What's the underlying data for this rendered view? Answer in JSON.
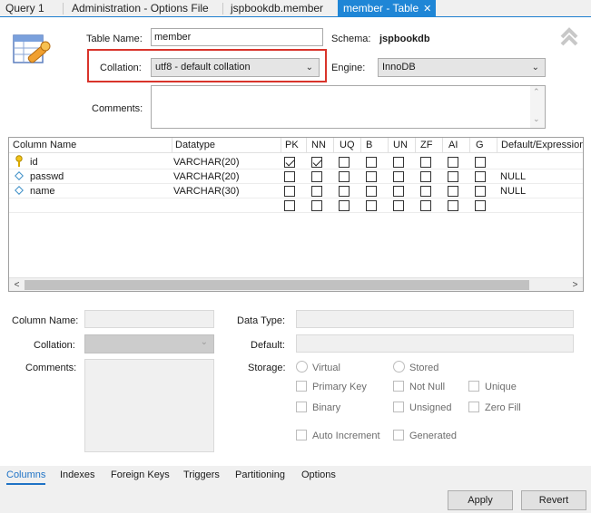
{
  "tabs": [
    {
      "label": "Query 1"
    },
    {
      "label": "Administration - Options File"
    },
    {
      "label": "jspbookdb.member"
    },
    {
      "label": "member - Table",
      "active": true
    }
  ],
  "tab_close_glyph": "✕",
  "table_form": {
    "table_name_label": "Table Name:",
    "table_name_value": "member",
    "schema_label": "Schema:",
    "schema_value": "jspbookdb",
    "collation_label": "Collation:",
    "collation_value": "utf8 - default collation",
    "engine_label": "Engine:",
    "engine_value": "InnoDB",
    "comments_label": "Comments:",
    "comments_value": "",
    "highlight_color": "#d9342b"
  },
  "grid": {
    "headers": [
      "Column Name",
      "Datatype",
      "PK",
      "NN",
      "UQ",
      "B",
      "UN",
      "ZF",
      "AI",
      "G",
      "Default/Expression"
    ],
    "rows": [
      {
        "icon": "key-icon",
        "name": "id",
        "type": "VARCHAR(20)",
        "flags": [
          true,
          true,
          false,
          false,
          false,
          false,
          false,
          false
        ],
        "default": ""
      },
      {
        "icon": "diamond-icon",
        "name": "passwd",
        "type": "VARCHAR(20)",
        "flags": [
          false,
          false,
          false,
          false,
          false,
          false,
          false,
          false
        ],
        "default": "NULL"
      },
      {
        "icon": "diamond-icon",
        "name": "name",
        "type": "VARCHAR(30)",
        "flags": [
          false,
          false,
          false,
          false,
          false,
          false,
          false,
          false
        ],
        "default": "NULL"
      },
      {
        "icon": "",
        "name": "",
        "type": "",
        "flags": [
          false,
          false,
          false,
          false,
          false,
          false,
          false,
          false
        ],
        "default": ""
      }
    ]
  },
  "details": {
    "column_name_label": "Column Name:",
    "collation_label": "Collation:",
    "comments_label": "Comments:",
    "data_type_label": "Data Type:",
    "default_label": "Default:",
    "storage_label": "Storage:",
    "virtual_label": "Virtual",
    "stored_label": "Stored",
    "primary_key_label": "Primary Key",
    "not_null_label": "Not Null",
    "unique_label": "Unique",
    "binary_label": "Binary",
    "unsigned_label": "Unsigned",
    "zero_fill_label": "Zero Fill",
    "auto_increment_label": "Auto Increment",
    "generated_label": "Generated"
  },
  "bottom_tabs": [
    "Columns",
    "Indexes",
    "Foreign Keys",
    "Triggers",
    "Partitioning",
    "Options"
  ],
  "buttons": {
    "apply": "Apply",
    "revert": "Revert"
  },
  "colors": {
    "accent": "#1f86d6",
    "active_tab_text": "#1f73c6"
  }
}
